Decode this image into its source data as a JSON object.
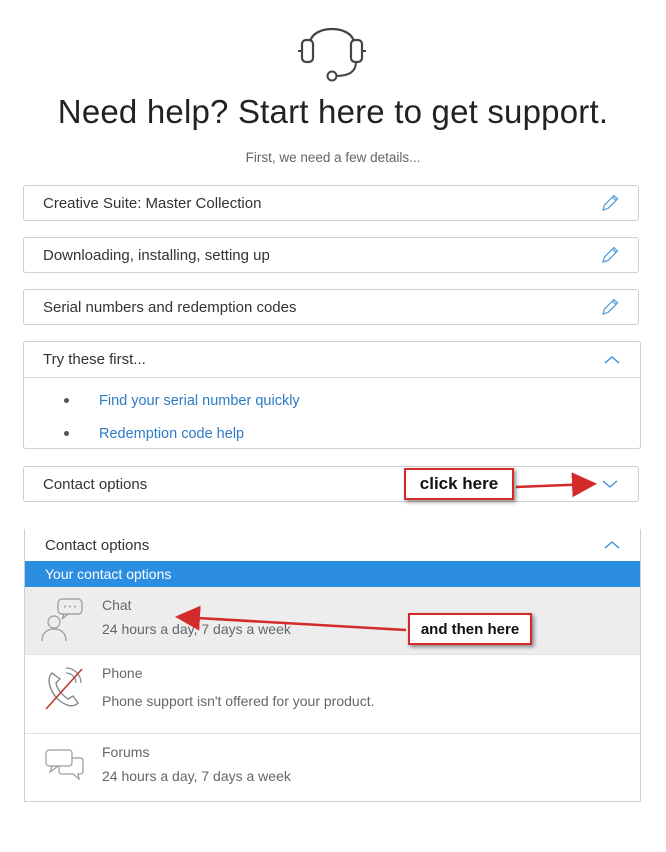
{
  "header": {
    "title": "Need help? Start here to get support.",
    "subtitle": "First, we need a few details..."
  },
  "selections": [
    {
      "label": "Creative Suite: Master Collection",
      "icon": "pencil-icon"
    },
    {
      "label": "Downloading, installing, setting up",
      "icon": "pencil-icon"
    },
    {
      "label": "Serial numbers and redemption codes",
      "icon": "pencil-icon"
    }
  ],
  "try_first": {
    "label": "Try these first...",
    "links": [
      "Find your serial number quickly",
      "Redemption code help"
    ]
  },
  "contact_collapsed": {
    "label": "Contact options"
  },
  "contact_expanded": {
    "label": "Contact options",
    "bar_label": "Your contact options",
    "options": [
      {
        "name": "Chat",
        "desc": "24 hours a day, 7 days a week",
        "icon": "chat-agent-icon"
      },
      {
        "name": "Phone",
        "desc": "Phone support isn't offered for your product.",
        "icon": "phone-disabled-icon"
      },
      {
        "name": "Forums",
        "desc": "24 hours a day, 7 days a week",
        "icon": "forums-icon"
      }
    ]
  },
  "annotations": {
    "click_here": "click here",
    "and_then_here": "and then here"
  },
  "colors": {
    "accent": "#2b8ee0",
    "link": "#2d7cc4",
    "annotation_red": "#d42a2a",
    "highlight_row": "#ededed"
  }
}
